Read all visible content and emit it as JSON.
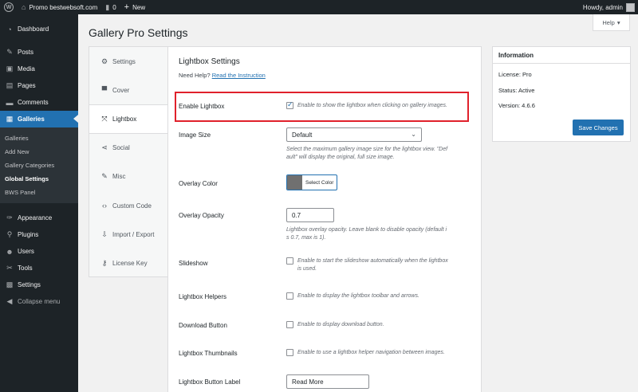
{
  "adminbar": {
    "site_name": "Promo bestwebsoft.com",
    "comments_count": "0",
    "new_label": "New",
    "howdy": "Howdy, admin"
  },
  "sidebar": {
    "items": [
      {
        "label": "Dashboard",
        "icon": "dashboard-icon"
      },
      {
        "label": "Posts",
        "icon": "pin-icon"
      },
      {
        "label": "Media",
        "icon": "media-icon"
      },
      {
        "label": "Pages",
        "icon": "pages-icon"
      },
      {
        "label": "Comments",
        "icon": "comments-icon"
      },
      {
        "label": "Galleries",
        "icon": "galleries-icon"
      }
    ],
    "submenu": [
      "Galleries",
      "Add New",
      "Gallery Categories",
      "Global Settings",
      "BWS Panel"
    ],
    "lower_items": [
      {
        "label": "Appearance",
        "icon": "appearance-icon"
      },
      {
        "label": "Plugins",
        "icon": "plugins-icon"
      },
      {
        "label": "Users",
        "icon": "users-icon"
      },
      {
        "label": "Tools",
        "icon": "tools-icon"
      },
      {
        "label": "Settings",
        "icon": "settings-icon"
      },
      {
        "label": "Collapse menu",
        "icon": "collapse-icon"
      }
    ]
  },
  "page": {
    "title": "Gallery Pro Settings",
    "help_label": "Help"
  },
  "tabs": [
    {
      "label": "Settings",
      "icon": "gear-icon"
    },
    {
      "label": "Cover",
      "icon": "cover-icon"
    },
    {
      "label": "Lightbox",
      "icon": "lightbox-icon"
    },
    {
      "label": "Social",
      "icon": "share-icon"
    },
    {
      "label": "Misc",
      "icon": "wrench-icon"
    },
    {
      "label": "Custom Code",
      "icon": "code-icon"
    },
    {
      "label": "Import / Export",
      "icon": "import-export-icon"
    },
    {
      "label": "License Key",
      "icon": "key-icon"
    }
  ],
  "panel": {
    "title": "Lightbox Settings",
    "need_help": "Need Help?",
    "instruction_link": "Read the Instruction",
    "enable_lightbox": {
      "label": "Enable Lightbox",
      "checked": true,
      "desc": "Enable to show the lightbox when clicking on gallery images."
    },
    "image_size": {
      "label": "Image Size",
      "value": "Default",
      "desc_line1": "Select the maximum gallery image size for the lightbox view. \"Def",
      "desc_line2": "ault\" will display the original, full size image."
    },
    "overlay_color": {
      "label": "Overlay Color",
      "button": "Select Color",
      "swatch": "#707070"
    },
    "overlay_opacity": {
      "label": "Overlay Opacity",
      "value": "0.7",
      "desc_line1": "Lightbox overlay opacity. Leave blank to disable opacity (default i",
      "desc_line2": "s 0.7, max is 1)."
    },
    "slideshow": {
      "label": "Slideshow",
      "desc_line1": "Enable to start the slideshow automatically when the lightbox",
      "desc_line2": "is used."
    },
    "helpers": {
      "label": "Lightbox Helpers",
      "desc": "Enable to display the lightbox toolbar and arrows."
    },
    "download": {
      "label": "Download Button",
      "desc": "Enable to display download button."
    },
    "thumbnails": {
      "label": "Lightbox Thumbnails",
      "desc": "Enable to use a lightbox helper navigation between images."
    },
    "button_label": {
      "label": "Lightbox Button Label",
      "value": "Read More"
    }
  },
  "info": {
    "title": "Information",
    "license": "License: Pro",
    "status": "Status: Active",
    "version": "Version: 4.6.6",
    "save_label": "Save Changes"
  },
  "colors": {
    "accent": "#2271b1",
    "admin_dark": "#1d2327",
    "highlight": "#e0212b"
  }
}
